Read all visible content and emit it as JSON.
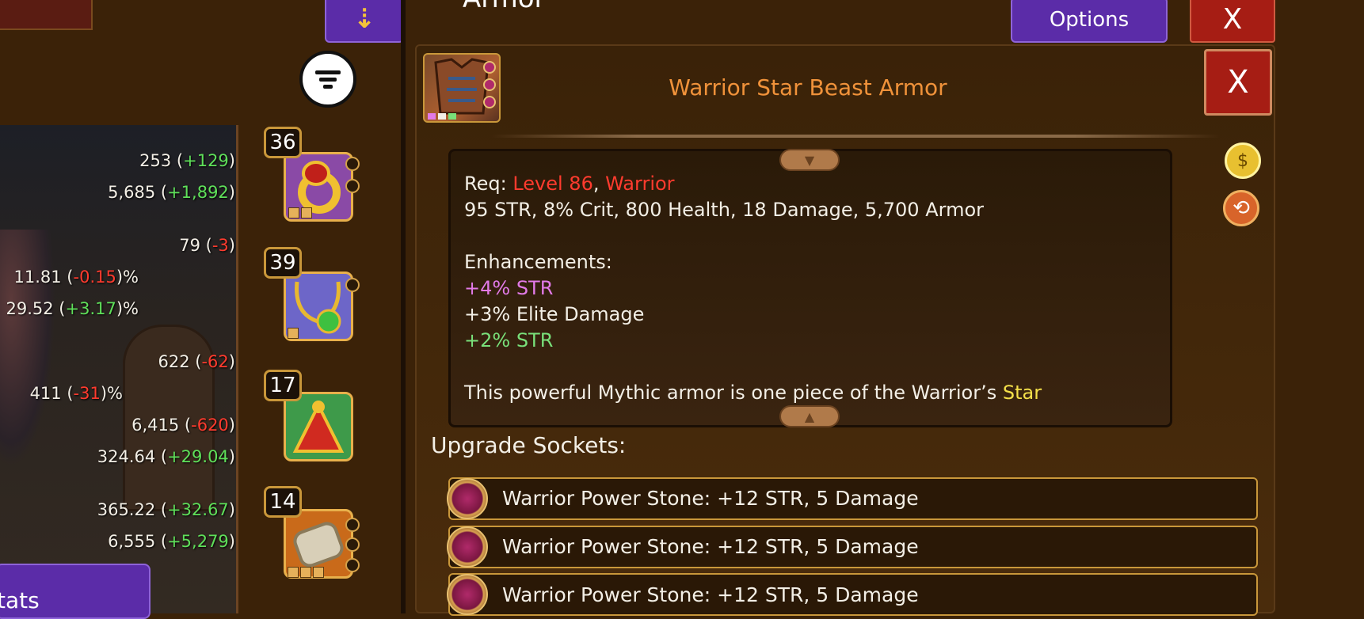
{
  "header": {
    "screen_title": "Armor",
    "options_label": "Options",
    "close_label": "X"
  },
  "stats": [
    {
      "base": "253",
      "open": " (",
      "delta": "+129",
      "close": ")",
      "type": "pos"
    },
    {
      "base": "5,685",
      "open": " (",
      "delta": "+1,892",
      "close": ")",
      "type": "pos"
    },
    {
      "base": "79",
      "open": " (",
      "delta": "-3",
      "close": ")",
      "type": "neg"
    },
    {
      "base": "11.81",
      "open": " (",
      "delta": "-0.15",
      "close": ")%",
      "type": "neg"
    },
    {
      "base": "29.52",
      "open": " (",
      "delta": "+3.17",
      "close": ")%",
      "type": "pos"
    },
    {
      "base": "622",
      "open": " (",
      "delta": "-62",
      "close": ")",
      "type": "neg"
    },
    {
      "base": "411",
      "open": " (",
      "delta": "-31",
      "close": ")%",
      "type": "neg"
    },
    {
      "base": "6,415",
      "open": " (",
      "delta": "-620",
      "close": ")",
      "type": "neg"
    },
    {
      "base": "324.64",
      "open": " (",
      "delta": "+29.04",
      "close": ")",
      "type": "pos"
    },
    {
      "base": "365.22",
      "open": " (",
      "delta": "+32.67",
      "close": ")",
      "type": "pos"
    },
    {
      "base": "6,555",
      "open": " (",
      "delta": "+5,279",
      "close": ")",
      "type": "pos"
    }
  ],
  "stats_button_label": "tats",
  "equipment_slots": [
    {
      "level": "36",
      "icon": "ring-icon"
    },
    {
      "level": "39",
      "icon": "amulet-icon"
    },
    {
      "level": "17",
      "icon": "trinket-icon"
    },
    {
      "level": "14",
      "icon": "bracer-icon"
    }
  ],
  "item": {
    "title": "Warrior Star Beast Armor",
    "req_label": "Req: ",
    "req_level": "Level 86",
    "req_sep": ", ",
    "req_class": "Warrior",
    "base_stats": "95 STR, 8% Crit, 800 Health, 18 Damage, 5,700 Armor",
    "enhancements_label": "Enhancements:",
    "enhancements": [
      {
        "text": "+4% STR",
        "color": "#e27ae8"
      },
      {
        "text": "+3% Elite Damage",
        "color": "#f3efe6"
      },
      {
        "text": "+2% STR",
        "color": "#79e07a"
      }
    ],
    "description_prefix": "This powerful Mythic armor is one piece of the Warrior’s ",
    "description_highlight": "Star"
  },
  "sockets": {
    "title": "Upgrade Sockets:",
    "items": [
      "Warrior Power Stone: +12 STR, 5 Damage",
      "Warrior Power Stone: +12 STR, 5 Damage",
      "Warrior Power Stone: +12 STR, 5 Damage"
    ]
  },
  "colors": {
    "accent_purple": "#5b2ca8",
    "close_red": "#a61d14",
    "title_orange": "#f0923a",
    "positive_green": "#5fe05a",
    "negative_red": "#ff3b2e"
  }
}
